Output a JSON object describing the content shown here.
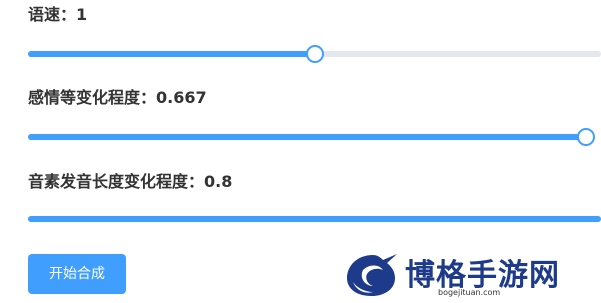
{
  "controls": [
    {
      "label": "语速：1",
      "value_fraction": 0.5
    },
    {
      "label": "感情等变化程度：0.667",
      "value_fraction": 1.0
    },
    {
      "label": "音素发音长度变化程度：0.8",
      "value_fraction": 1.0
    }
  ],
  "actions": {
    "start_synthesis_label": "开始合成"
  },
  "watermark": {
    "brand_name": "博格手游网",
    "domain": "bogejituan.com"
  },
  "colors": {
    "accent": "#409eff",
    "track": "#e4e7ed",
    "text": "#333333",
    "brand": "#1e3a8a"
  }
}
